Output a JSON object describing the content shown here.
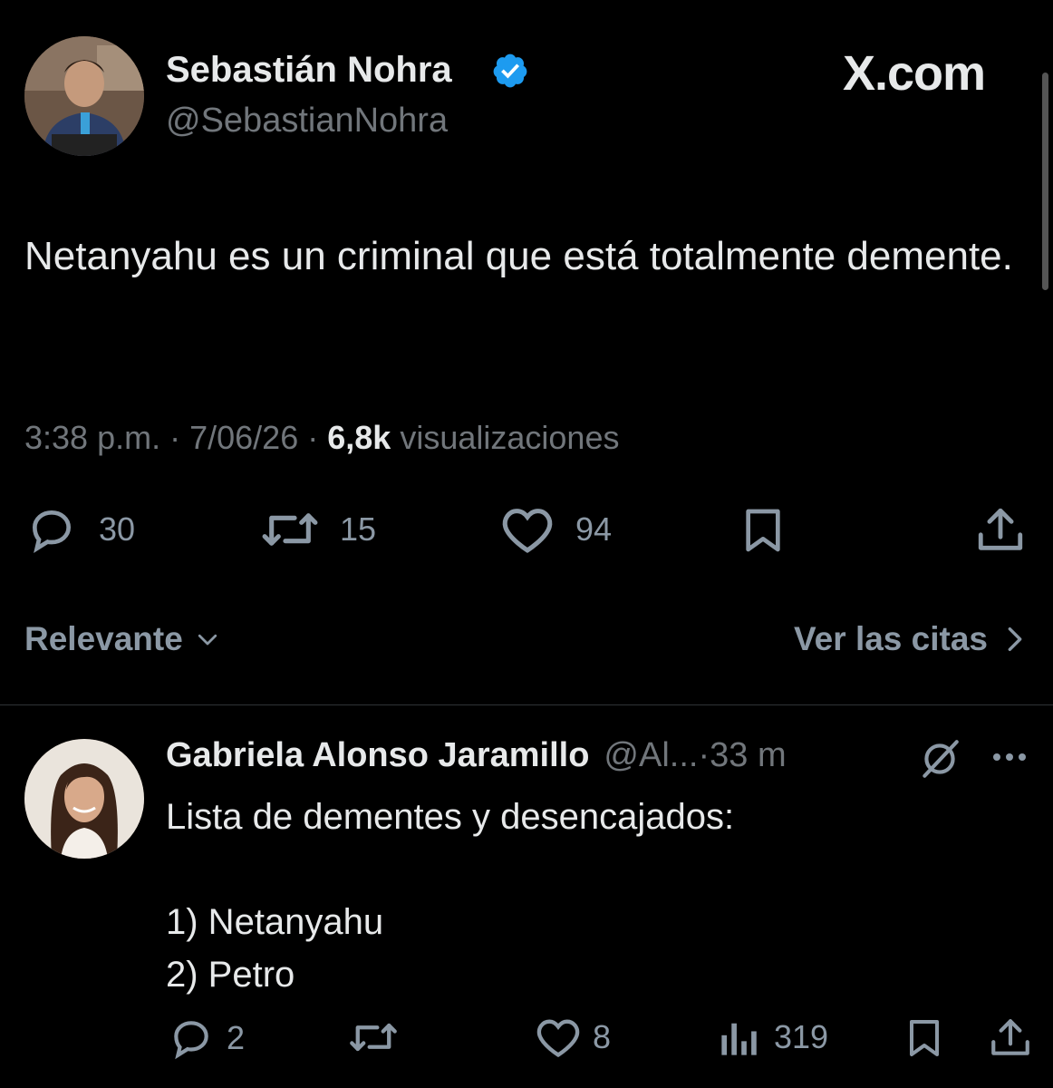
{
  "main_tweet": {
    "author_name": "Sebastián Nohra",
    "author_handle": "@SebastianNohra",
    "verified_icon": "verified-badge-icon",
    "brand": "X.com",
    "text": "Netanyahu es un criminal que está totalmente demente.",
    "time": "3:38 p.m.",
    "date": "7/06/26",
    "views_count": "6,8k",
    "views_label": "visualizaciones",
    "actions": {
      "replies": "30",
      "reposts": "15",
      "likes": "94"
    }
  },
  "sort": {
    "label": "Relevante",
    "quotes_label": "Ver las citas"
  },
  "reply": {
    "author_name": "Gabriela Alonso Jaramillo",
    "author_handle": "@Al...",
    "time": "·33 m",
    "text": "Lista de dementes y desencajados:\n\n1) Netanyahu\n2) Petro",
    "actions": {
      "replies": "2",
      "likes": "8",
      "views": "319"
    }
  },
  "colors": {
    "background": "#000000",
    "text": "#e7e9ea",
    "muted": "#71767b",
    "verified": "#1d9bf0"
  }
}
